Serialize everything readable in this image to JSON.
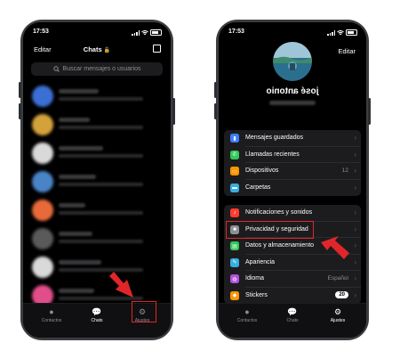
{
  "left_phone": {
    "status": {
      "time": "17:53"
    },
    "nav": {
      "edit_label": "Editar",
      "title": "Chats"
    },
    "search": {
      "placeholder": "Buscar mensajes o usuarios"
    },
    "chats": [
      {
        "avatar_color": "#3b6fd4"
      },
      {
        "avatar_color": "#d4a23b"
      },
      {
        "avatar_color": "#d9d9d9"
      },
      {
        "avatar_color": "#4a84c8"
      },
      {
        "avatar_color": "#e86a3a"
      },
      {
        "avatar_color": "#5a5a5a"
      },
      {
        "avatar_color": "#d9d9d9"
      },
      {
        "avatar_color": "#e14e8a"
      },
      {
        "avatar_color": "#4a7ad8"
      }
    ],
    "tabs": [
      {
        "label": "Contactos",
        "icon": "person-icon"
      },
      {
        "label": "Chats",
        "icon": "chat-bubble-icon"
      },
      {
        "label": "Ajustes",
        "icon": "gear-icon"
      }
    ]
  },
  "right_phone": {
    "status": {
      "time": "17:53"
    },
    "edit_label": "Editar",
    "profile": {
      "name": "josé antonio"
    },
    "group1": [
      {
        "label": "Mensajes guardados",
        "icon": "bookmark-icon",
        "color": "#3d7ff5"
      },
      {
        "label": "Llamadas recientes",
        "icon": "phone-icon",
        "color": "#34c759"
      },
      {
        "label": "Dispositivos",
        "value": "12",
        "icon": "devices-icon",
        "color": "#ff9500"
      },
      {
        "label": "Carpetas",
        "icon": "folder-icon",
        "color": "#37aee2"
      }
    ],
    "group2": [
      {
        "label": "Notificaciones y sonidos",
        "icon": "bell-icon",
        "color": "#ff3b30"
      },
      {
        "label": "Privacidad y seguridad",
        "icon": "lock-icon",
        "color": "#8e8e93"
      },
      {
        "label": "Datos y almacenamiento",
        "icon": "data-icon",
        "color": "#34c759"
      },
      {
        "label": "Apariencia",
        "icon": "brush-icon",
        "color": "#37aee2"
      },
      {
        "label": "Idioma",
        "value": "Español",
        "icon": "globe-icon",
        "color": "#af52de"
      },
      {
        "label": "Stickers",
        "badge": "20",
        "icon": "sticker-icon",
        "color": "#ff9500"
      }
    ],
    "tabs": [
      {
        "label": "Contactos",
        "icon": "person-icon"
      },
      {
        "label": "Chats",
        "icon": "chat-bubble-icon"
      },
      {
        "label": "Ajustes",
        "icon": "gear-icon"
      }
    ]
  },
  "colors": {
    "highlight": "#e0262b",
    "arrow": "#e0262b"
  }
}
